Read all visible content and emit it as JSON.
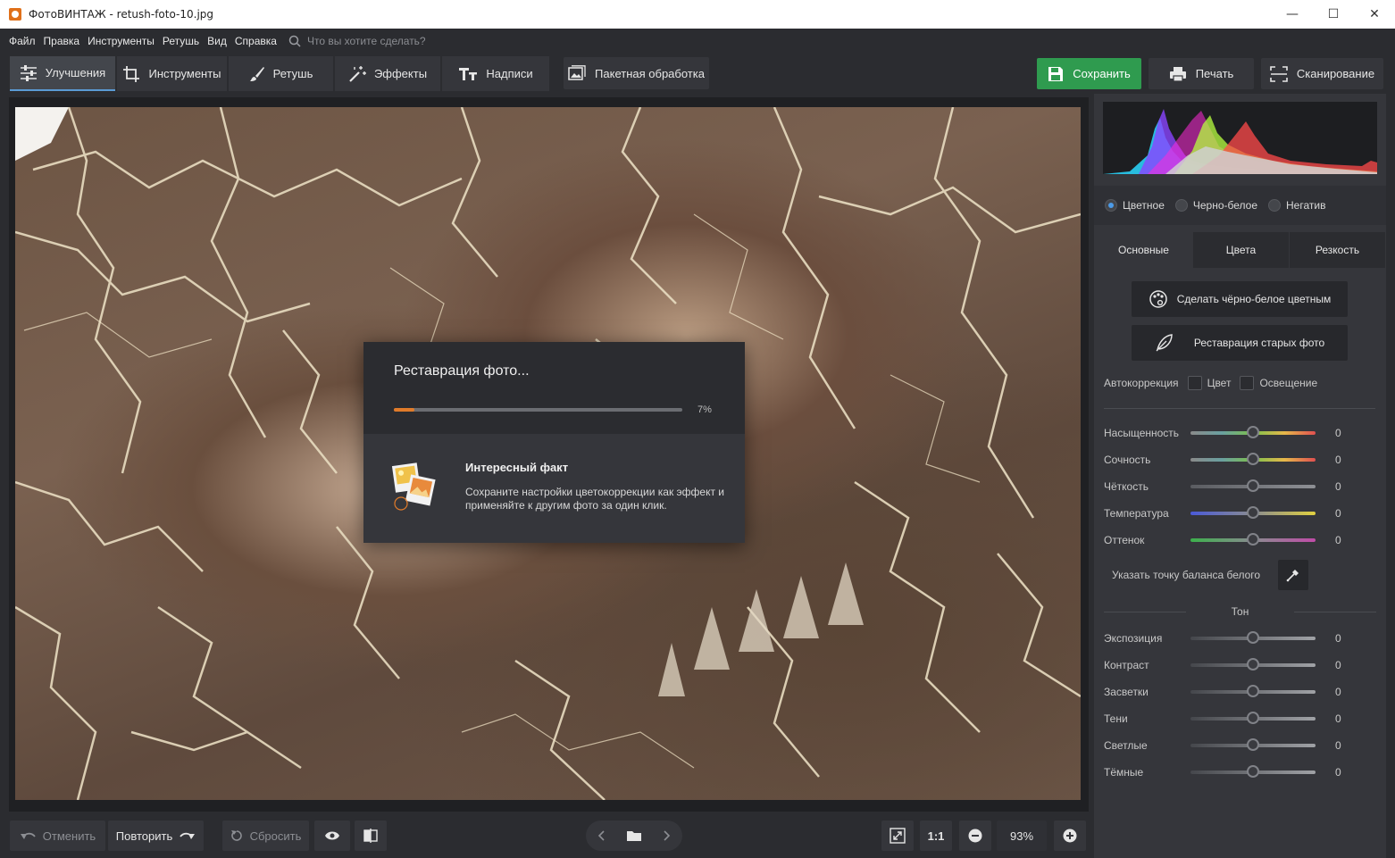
{
  "window": {
    "title": "ФотоВИНТАЖ - retush-foto-10.jpg",
    "minimize": "—",
    "maximize": "☐",
    "close": "✕"
  },
  "menu": {
    "items": [
      "Файл",
      "Правка",
      "Инструменты",
      "Ретушь",
      "Вид",
      "Справка"
    ],
    "search_placeholder": "Что вы хотите сделать?"
  },
  "tabs": [
    {
      "label": "Улучшения",
      "active": true,
      "icon": "sliders-icon"
    },
    {
      "label": "Инструменты",
      "active": false,
      "icon": "crop-icon"
    },
    {
      "label": "Ретушь",
      "active": false,
      "icon": "brush-icon"
    },
    {
      "label": "Эффекты",
      "active": false,
      "icon": "magic-wand-icon"
    },
    {
      "label": "Надписи",
      "active": false,
      "icon": "text-icon"
    }
  ],
  "batch_label": "Пакетная обработка",
  "actions": {
    "save": "Сохранить",
    "print": "Печать",
    "scan": "Сканирование"
  },
  "dialog": {
    "title": "Реставрация фото...",
    "progress_percent": 7,
    "progress_label": "7%",
    "fact_title": "Интересный факт",
    "fact_text": "Сохраните настройки цветокоррекции как эффект и применяйте к другим фото за один клик."
  },
  "bottom": {
    "undo": "Отменить",
    "redo": "Повторить",
    "reset": "Сбросить",
    "one_to_one": "1:1",
    "zoom": "93%"
  },
  "panel": {
    "modes": [
      {
        "label": "Цветное",
        "selected": true
      },
      {
        "label": "Черно-белое",
        "selected": false
      },
      {
        "label": "Негатив",
        "selected": false
      }
    ],
    "subtabs": [
      "Основные",
      "Цвета",
      "Резкость"
    ],
    "colorize_button": "Сделать чёрно-белое цветным",
    "restore_button": "Реставрация старых фото",
    "autocorrection": {
      "label": "Автокоррекция",
      "color": "Цвет",
      "lighting": "Освещение"
    },
    "sliders": [
      {
        "label": "Насыщенность",
        "value": "0",
        "gradient": "linear-gradient(90deg,#8a8a8a,#6aa0a0,#7cc04c,#e6b84a,#e05050)"
      },
      {
        "label": "Сочность",
        "value": "0",
        "gradient": "linear-gradient(90deg,#8a8a8a,#6aa0a0,#7cc04c,#e6b84a,#e05050)"
      },
      {
        "label": "Чёткость",
        "value": "0",
        "gradient": "linear-gradient(90deg,#5a5c61,#8e9095)"
      },
      {
        "label": "Температура",
        "value": "0",
        "gradient": "linear-gradient(90deg,#4a5ad8,#8a8c90,#e0d040)"
      },
      {
        "label": "Оттенок",
        "value": "0",
        "gradient": "linear-gradient(90deg,#3cb04c,#8a8c90,#c04ca8)"
      }
    ],
    "white_balance": "Указать точку баланса белого",
    "tone_label": "Тон",
    "tone_sliders": [
      {
        "label": "Экспозиция",
        "value": "0",
        "gradient": "linear-gradient(90deg,#45474c,#a0a2a6)"
      },
      {
        "label": "Контраст",
        "value": "0",
        "gradient": "linear-gradient(90deg,#45474c,#a0a2a6)"
      },
      {
        "label": "Засветки",
        "value": "0",
        "gradient": "linear-gradient(90deg,#45474c,#a0a2a6)"
      },
      {
        "label": "Тени",
        "value": "0",
        "gradient": "linear-gradient(90deg,#45474c,#a0a2a6)"
      },
      {
        "label": "Светлые",
        "value": "0",
        "gradient": "linear-gradient(90deg,#45474c,#a0a2a6)"
      },
      {
        "label": "Тёмные",
        "value": "0",
        "gradient": "linear-gradient(90deg,#45474c,#a0a2a6)"
      }
    ]
  },
  "colors": {
    "accent": "#4c9be8",
    "save": "#2f9b4f",
    "progress": "#e07b2a"
  }
}
